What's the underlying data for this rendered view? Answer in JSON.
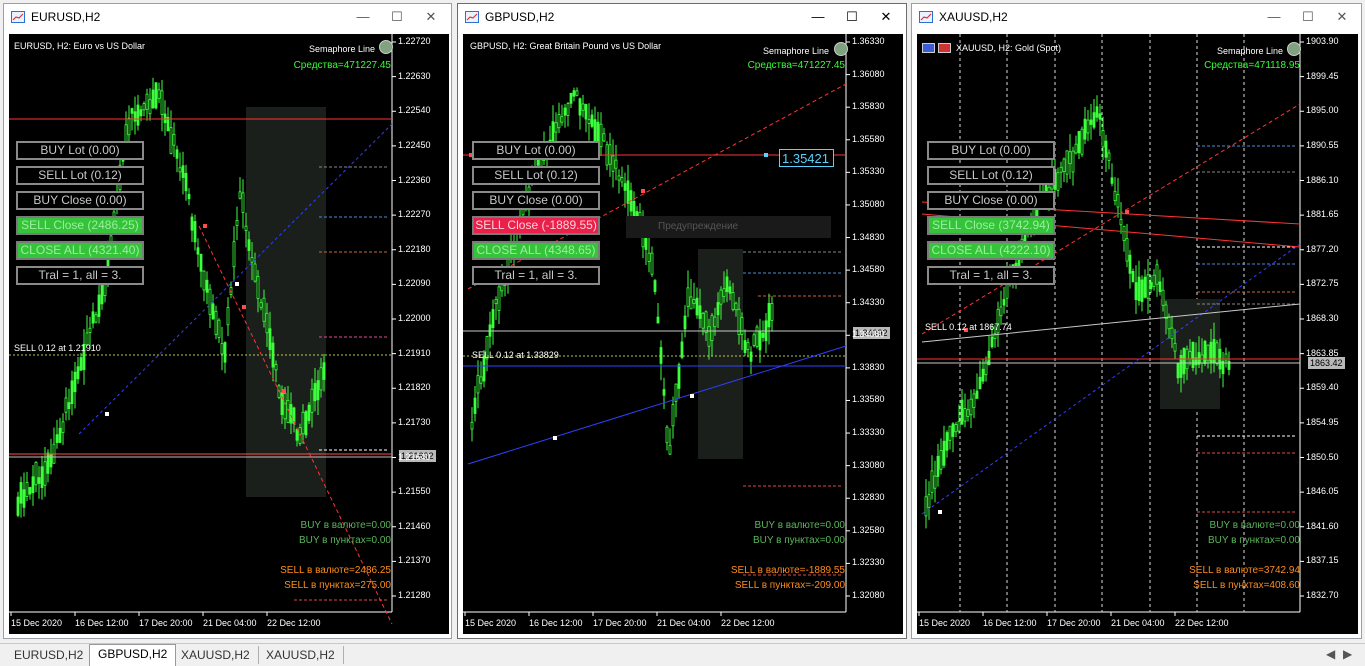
{
  "windows": [
    {
      "title": "EURUSD,H2",
      "chart_label": "EURUSD, H2:  Euro vs US Dollar",
      "semaphore": "Semaphore Line",
      "equity": "Средства=471227.45",
      "buttons": [
        "BUY Lot (0.00)",
        "SELL Lot (0.12)",
        "BUY Close (0.00)",
        "SELL Close (2486.25)",
        "CLOSE ALL (4321.40)",
        "Tral = 1, all = 3."
      ],
      "sell_line": "SELL 0.12 at 1.21910",
      "price_tag": "1.21632",
      "y_ticks": [
        "1.22720",
        "1.22630",
        "1.22540",
        "1.22450",
        "1.22360",
        "1.22270",
        "1.22180",
        "1.22090",
        "1.22000",
        "1.21910",
        "1.21820",
        "1.21730",
        "1.21640",
        "1.21550",
        "1.21460",
        "1.21370",
        "1.21280"
      ],
      "x_ticks": [
        "15 Dec 2020",
        "16 Dec 12:00",
        "17 Dec 20:00",
        "21 Dec 04:00",
        "22 Dec 12:00"
      ],
      "buy_currency": "BUY в валюте=0.00",
      "buy_points": "BUY в пунктах=0.00",
      "sell_currency": "SELL в валюте=2486.25",
      "sell_points": "SELL в пунктах=275.00"
    },
    {
      "title": "GBPUSD,H2",
      "chart_label": "GBPUSD, H2:  Great Britain Pound vs US Dollar",
      "semaphore": "Semaphore Line",
      "equity": "Средства=471227.45",
      "buttons": [
        "BUY Lot (0.00)",
        "SELL Lot (0.12)",
        "BUY Close (0.00)",
        "SELL Close (-1889.55)",
        "CLOSE ALL (4348.65)",
        "Tral = 1, all = 3."
      ],
      "sell_line": "SELL 0.12 at 1.33829",
      "price_tag": "1.34092",
      "cursor_price": "1.35421",
      "overlay_text": "Предупреждение",
      "y_ticks": [
        "1.36330",
        "1.36080",
        "1.35830",
        "1.35580",
        "1.35330",
        "1.35080",
        "1.34830",
        "1.34580",
        "1.34330",
        "1.34080",
        "1.33830",
        "1.33580",
        "1.33330",
        "1.33080",
        "1.32830",
        "1.32580",
        "1.32330",
        "1.32080"
      ],
      "x_ticks": [
        "15 Dec 2020",
        "16 Dec 12:00",
        "17 Dec 20:00",
        "21 Dec 04:00",
        "22 Dec 12:00"
      ],
      "buy_currency": "BUY в валюте=0.00",
      "buy_points": "BUY в пунктах=0.00",
      "sell_currency": "SELL в валюте=-1889.55",
      "sell_points": "SELL в пунктах=-209.00"
    },
    {
      "title": "XAUUSD,H2",
      "chart_label": "XAUUSD, H2:  Gold (Spot)",
      "semaphore": "Semaphore Line",
      "equity": "Средства=471118.95",
      "buttons": [
        "BUY Lot (0.00)",
        "SELL Lot (0.12)",
        "BUY Close (0.00)",
        "SELL Close (3742.94)",
        "CLOSE ALL (4222.10)",
        "Tral = 1, all = 3."
      ],
      "sell_line": "SELL 0.12 at 1867.74",
      "price_tag": "1863.42",
      "y_ticks": [
        "1903.90",
        "1899.45",
        "1895.00",
        "1890.55",
        "1886.10",
        "1881.65",
        "1877.20",
        "1872.75",
        "1868.30",
        "1863.85",
        "1859.40",
        "1854.95",
        "1850.50",
        "1846.05",
        "1841.60",
        "1837.15",
        "1832.70"
      ],
      "x_ticks": [
        "15 Dec 2020",
        "16 Dec 12:00",
        "17 Dec 20:00",
        "21 Dec 04:00",
        "22 Dec 12:00"
      ],
      "buy_currency": "BUY в валюте=0.00",
      "buy_points": "BUY в пунктах=0.00",
      "sell_currency": "SELL в валюте=3742.94",
      "sell_points": "SELL в пунктах=408.60"
    }
  ],
  "window_controls": {
    "minimize": "—",
    "maximize": "☐",
    "close": "✕"
  },
  "tabs": [
    "EURUSD,H2",
    "GBPUSD,H2",
    "XAUUSD,H2",
    "XAUUSD,H2"
  ],
  "tab_arrows": {
    "left": "◀",
    "right": "▶"
  },
  "colors": {
    "candle": "#3cff3c",
    "sell_button": "#e8204a",
    "green_button": "#35c33a",
    "equity": "#33ff33",
    "sell_info": "#ff8c1a"
  }
}
